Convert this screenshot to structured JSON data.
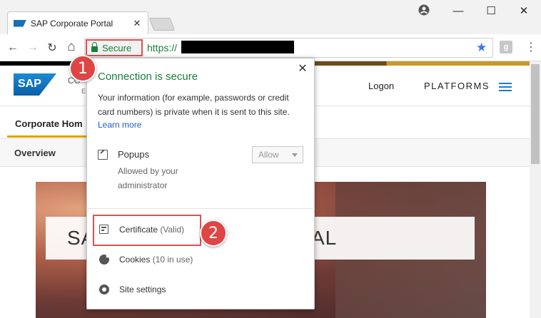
{
  "browser": {
    "tab_title": "SAP Corporate Portal",
    "tab_close": "✕",
    "window_minimize": "—",
    "window_maximize": "☐",
    "window_close": "✕",
    "nav_back": "←",
    "nav_forward": "→",
    "nav_reload": "↻",
    "nav_home": "⌂",
    "secure_label": "Secure",
    "url_prefix": "https://",
    "bookmark_star": "★",
    "extension_label": "g",
    "menu": "⋮"
  },
  "page": {
    "logo_text": "SAP",
    "brand_fragment": "CO",
    "brand_fragment2": "E",
    "logon": "Logon",
    "platforms": "PLATFORMS",
    "tab_corporate_home": "Corporate Hom",
    "overview": "Overview",
    "hero_left": "SA",
    "hero_right": "AL"
  },
  "popup": {
    "close": "✕",
    "title": "Connection is secure",
    "description": "Your information (for example, passwords or credit card numbers) is private when it is sent to this site.",
    "learn_more": "Learn more",
    "popups_label": "Popups",
    "popups_sub": "Allowed by your administrator",
    "allow_value": "Allow",
    "certificate_label": "Certificate",
    "certificate_status": "(Valid)",
    "cookies_label": "Cookies",
    "cookies_status": "(10 in use)",
    "site_settings": "Site settings"
  },
  "callouts": {
    "one": "1",
    "two": "2"
  },
  "colors": {
    "secure_green": "#188038",
    "callout_red": "#e04545",
    "link_blue": "#1a62d2"
  }
}
